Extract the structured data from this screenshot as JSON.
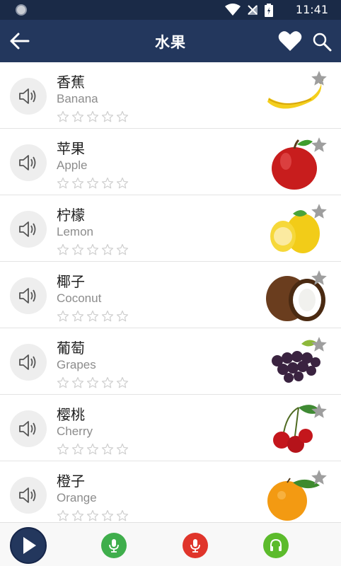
{
  "status_bar": {
    "time": "11:41"
  },
  "app_bar": {
    "title": "水果"
  },
  "colors": {
    "header": "#23375d",
    "status": "#1a2a47",
    "mic_green": "#3fae4c",
    "mic_red": "#e0352b",
    "headphone_green": "#5cbb2c"
  },
  "items": [
    {
      "cn": "香蕉",
      "en": "Banana",
      "stars": 0,
      "image": "banana-image"
    },
    {
      "cn": "苹果",
      "en": "Apple",
      "stars": 0,
      "image": "apple-image"
    },
    {
      "cn": "柠檬",
      "en": "Lemon",
      "stars": 0,
      "image": "lemon-image"
    },
    {
      "cn": "椰子",
      "en": "Coconut",
      "stars": 0,
      "image": "coconut-image"
    },
    {
      "cn": "葡萄",
      "en": "Grapes",
      "stars": 0,
      "image": "grapes-image"
    },
    {
      "cn": "樱桃",
      "en": "Cherry",
      "stars": 0,
      "image": "cherry-image"
    },
    {
      "cn": "橙子",
      "en": "Orange",
      "stars": 0,
      "image": "orange-image"
    }
  ],
  "bottom_bar": {
    "buttons": [
      "play-icon",
      "microphone-icon",
      "record-microphone-icon",
      "headphones-icon"
    ]
  }
}
